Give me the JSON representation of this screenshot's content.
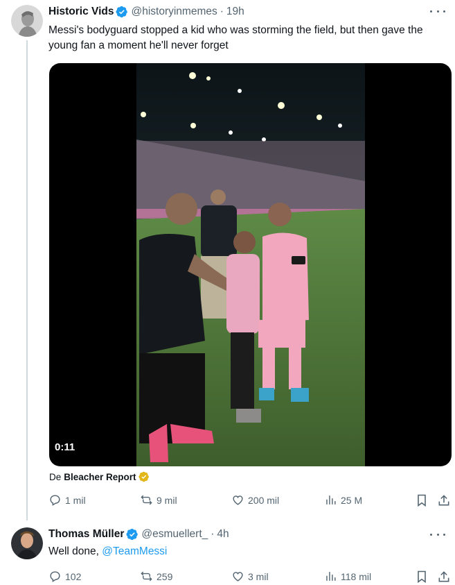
{
  "colors": {
    "text": "#0f1419",
    "secondary": "#536471",
    "accent": "#1d9bf0",
    "verified": "#1d9bf0",
    "gold_badge": "#e2b719"
  },
  "tweets": [
    {
      "author_name": "Historic Vids",
      "handle": "@historyinmemes",
      "separator": "·",
      "time": "19h",
      "verified_icon": "verified-badge-icon",
      "text": "Messi's bodyguard stopped a kid who was storming the field, but then gave the young fan a moment he'll never forget",
      "media": {
        "type": "video",
        "duration": "0:11"
      },
      "attribution": {
        "prefix": "De",
        "source": "Bleacher Report"
      },
      "stats": {
        "replies": "1 mil",
        "reposts": "9 mil",
        "likes": "200 mil",
        "views": "25 M"
      }
    },
    {
      "author_name": "Thomas Müller",
      "handle": "@esmuellert_",
      "separator": "·",
      "time": "4h",
      "verified_icon": "verified-badge-icon",
      "text_prefix": "Well done, ",
      "mention": "@TeamMessi",
      "stats": {
        "replies": "102",
        "reposts": "259",
        "likes": "3 mil",
        "views": "118 mil"
      }
    }
  ]
}
